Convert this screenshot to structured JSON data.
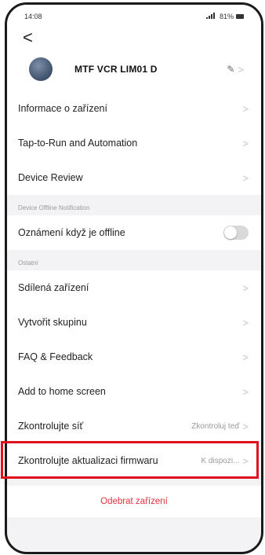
{
  "status_bar": {
    "time": "14:08",
    "battery": "81%",
    "icons": [
      "signal-icon",
      "battery-icon"
    ]
  },
  "nav": {
    "back_glyph": "<"
  },
  "device": {
    "name": "MTF VCR LIM01 D",
    "edit_glyph": "✎"
  },
  "group1": {
    "items": [
      {
        "label": "Informace o zařízení"
      },
      {
        "label": "Tap-to-Run and Automation"
      },
      {
        "label": "Device Review"
      }
    ]
  },
  "offline_section": {
    "label": "Device Offline Notification",
    "toggle_label": "Oznámení když je offline",
    "toggle_on": false
  },
  "other_section": {
    "label": "Ostatní",
    "items": [
      {
        "label": "Sdílená zařízení"
      },
      {
        "label": "Vytvořit skupinu"
      },
      {
        "label": "FAQ & Feedback"
      },
      {
        "label": "Add to home screen"
      },
      {
        "label": "Zkontrolujte síť",
        "value": "Zkontroluj teď"
      },
      {
        "label": "Zkontrolujte aktualizaci firmwaru",
        "value": "K dispozi..."
      }
    ]
  },
  "remove": {
    "label": "Odebrat zařízení"
  },
  "chevron": ">",
  "colors": {
    "highlight": "#e0101e",
    "remove": "#e5323e"
  }
}
